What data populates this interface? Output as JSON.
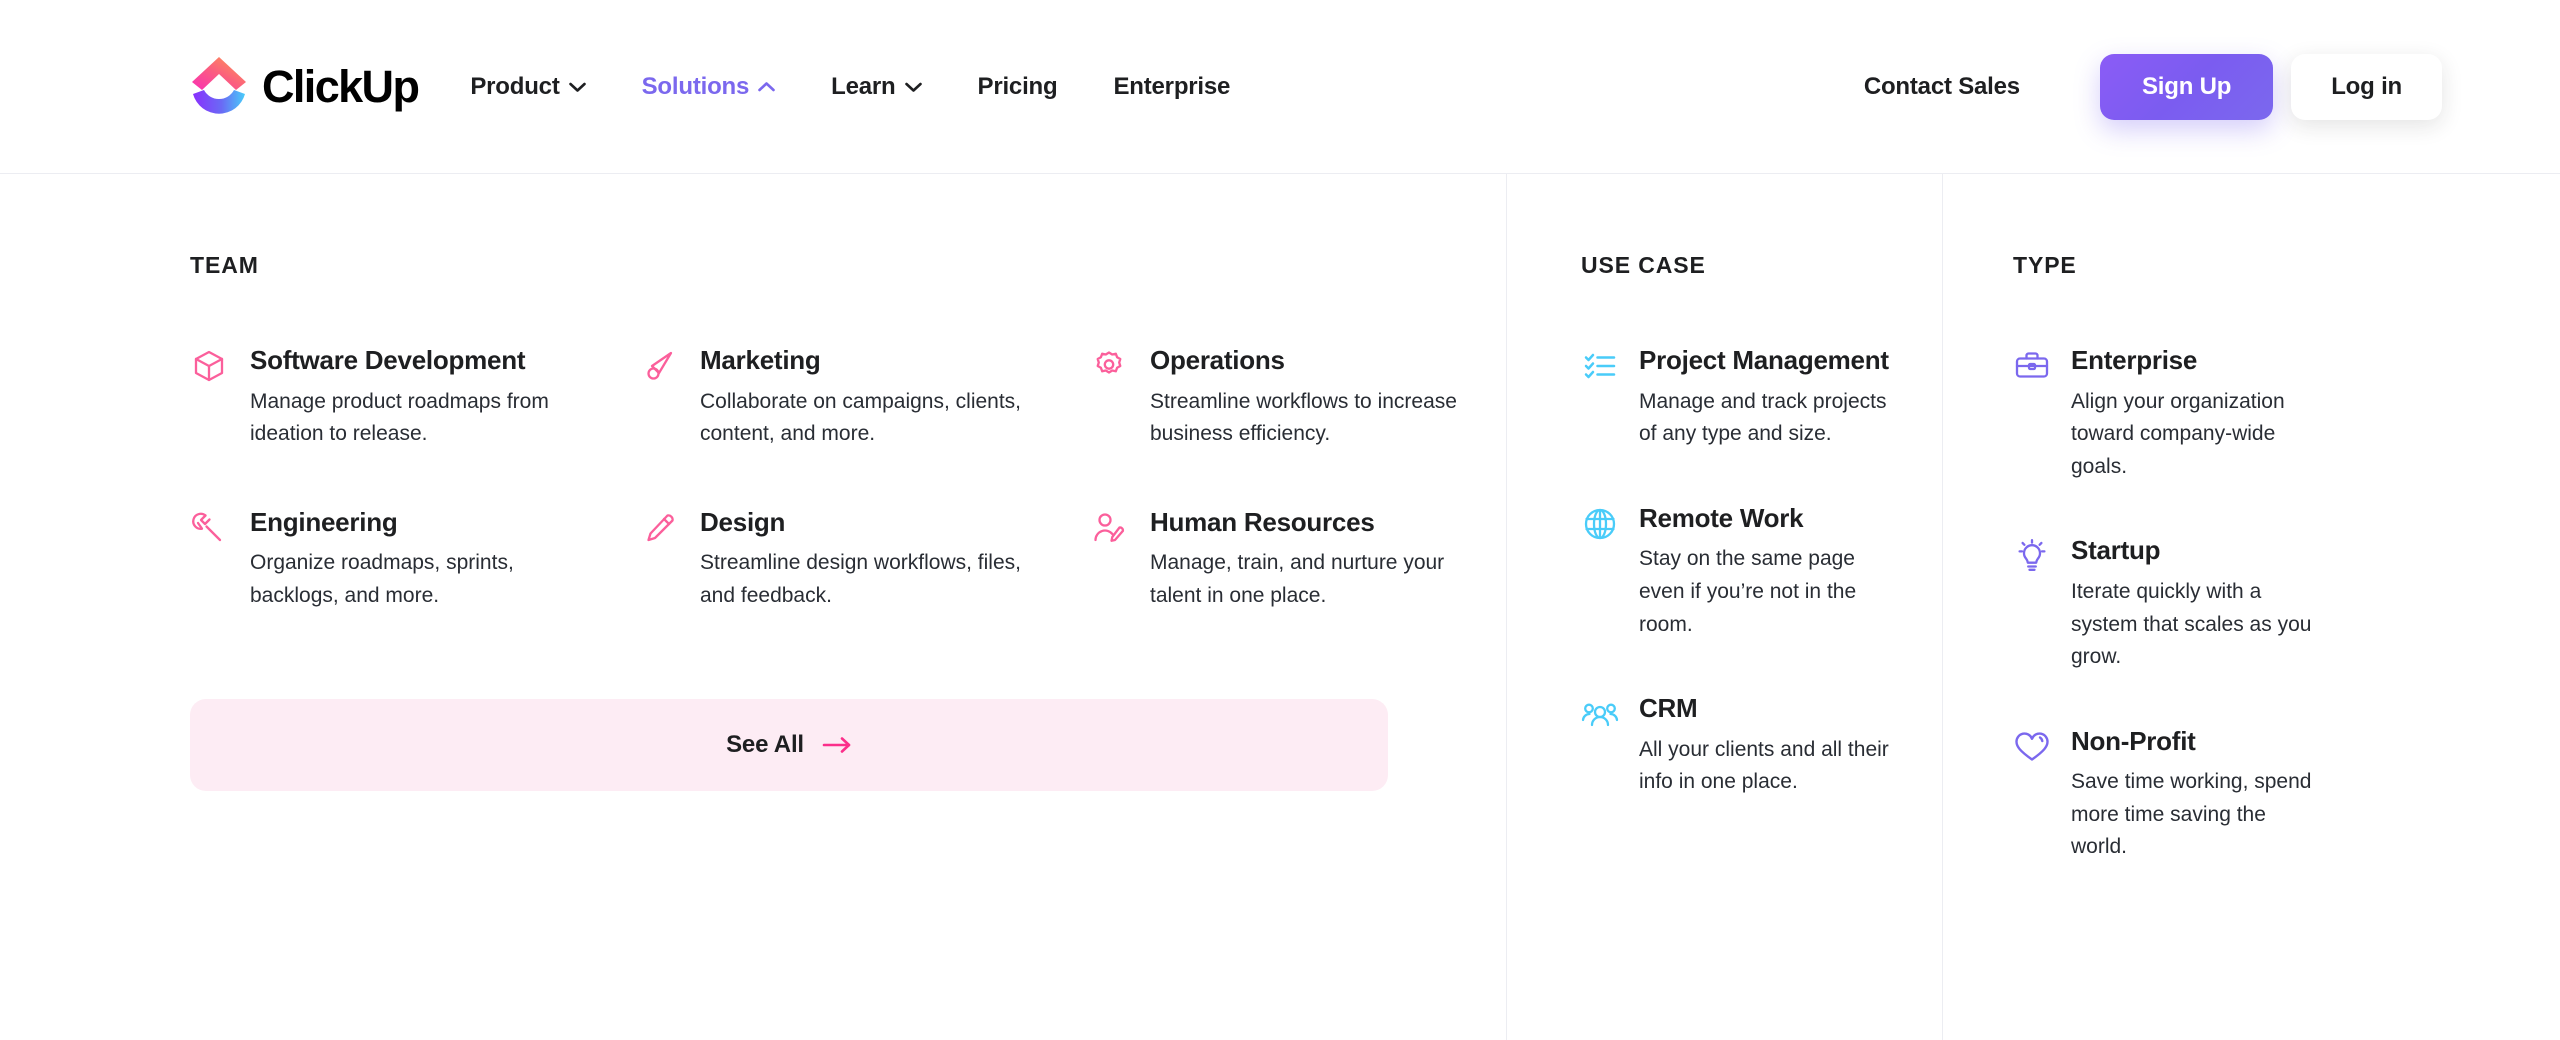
{
  "header": {
    "brand": {
      "name": "ClickUp",
      "icon": "clickup-logo-icon"
    },
    "nav": [
      {
        "label": "Product",
        "has_caret": true,
        "active": false
      },
      {
        "label": "Solutions",
        "has_caret": true,
        "active": true
      },
      {
        "label": "Learn",
        "has_caret": true,
        "active": false
      },
      {
        "label": "Pricing",
        "has_caret": false,
        "active": false
      },
      {
        "label": "Enterprise",
        "has_caret": false,
        "active": false
      }
    ],
    "contact_sales": "Contact Sales",
    "sign_up": "Sign Up",
    "log_in": "Log in"
  },
  "colors": {
    "accent_purple": "#7b68ee",
    "icon_pink": "#fb5f9b",
    "icon_cyan": "#49ccf9",
    "icon_purple": "#7b68ee",
    "see_all_bg": "#fdecf4",
    "text_dark": "#1e1f21",
    "divider": "#ecedf2"
  },
  "mega_menu": {
    "team": {
      "heading": "TEAM",
      "items": [
        {
          "title": "Software Development",
          "desc": "Manage product roadmaps from ideation to release.",
          "icon": "cube-icon"
        },
        {
          "title": "Marketing",
          "desc": "Collaborate on campaigns, clients, content, and more.",
          "icon": "megaphone-icon"
        },
        {
          "title": "Operations",
          "desc": "Streamline workflows to increase business efficiency.",
          "icon": "gear-icon"
        },
        {
          "title": "Engineering",
          "desc": "Organize roadmaps, sprints, backlogs, and more.",
          "icon": "wrench-icon"
        },
        {
          "title": "Design",
          "desc": "Streamline design workflows, files, and feedback.",
          "icon": "pencil-icon"
        },
        {
          "title": "Human Resources",
          "desc": "Manage, train, and nurture your talent in one place.",
          "icon": "person-edit-icon"
        }
      ],
      "see_all": {
        "label": "See All",
        "icon": "arrow-right-icon"
      }
    },
    "use_case": {
      "heading": "USE CASE",
      "items": [
        {
          "title": "Project Management",
          "desc": "Manage and track projects of any type and size.",
          "icon": "checklist-icon"
        },
        {
          "title": "Remote Work",
          "desc": "Stay on the same page even if you’re not in the room.",
          "icon": "globe-icon"
        },
        {
          "title": "CRM",
          "desc": "All your clients and all their info in one place.",
          "icon": "people-group-icon"
        }
      ]
    },
    "type": {
      "heading": "TYPE",
      "items": [
        {
          "title": "Enterprise",
          "desc": "Align your organization toward company-wide goals.",
          "icon": "briefcase-icon"
        },
        {
          "title": "Startup",
          "desc": "Iterate quickly with a system that scales as you grow.",
          "icon": "lightbulb-icon"
        },
        {
          "title": "Non-Profit",
          "desc": "Save time working, spend more time saving the world.",
          "icon": "heart-icon"
        }
      ]
    }
  }
}
